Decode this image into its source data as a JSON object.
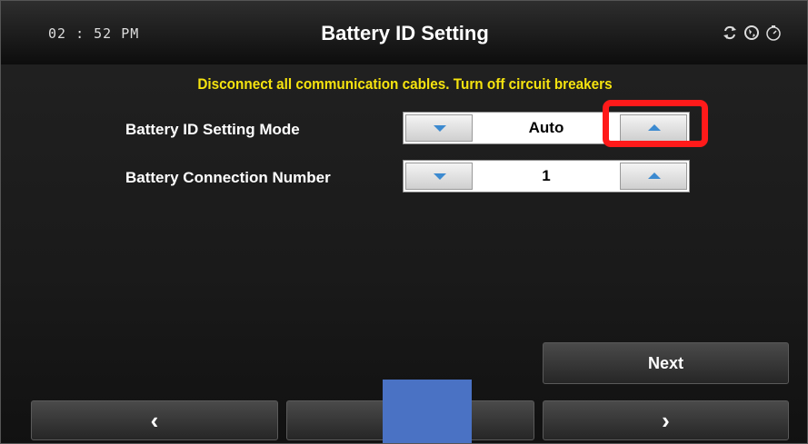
{
  "header": {
    "clock": "02 : 52 PM",
    "title": "Battery ID Setting",
    "icons": [
      "sync-icon",
      "globe-icon",
      "gauge-icon"
    ]
  },
  "warning": "Disconnect all communication cables. Turn off circuit breakers",
  "settings": [
    {
      "label": "Battery ID Setting Mode",
      "value": "Auto"
    },
    {
      "label": "Battery Connection Number",
      "value": "1"
    }
  ],
  "buttons": {
    "next": "Next",
    "prev_arrow": "‹",
    "next_arrow": "›"
  },
  "colors": {
    "warning": "#f5e30f",
    "arrow": "#3c8ad0",
    "highlight": "#ff1a1a"
  }
}
